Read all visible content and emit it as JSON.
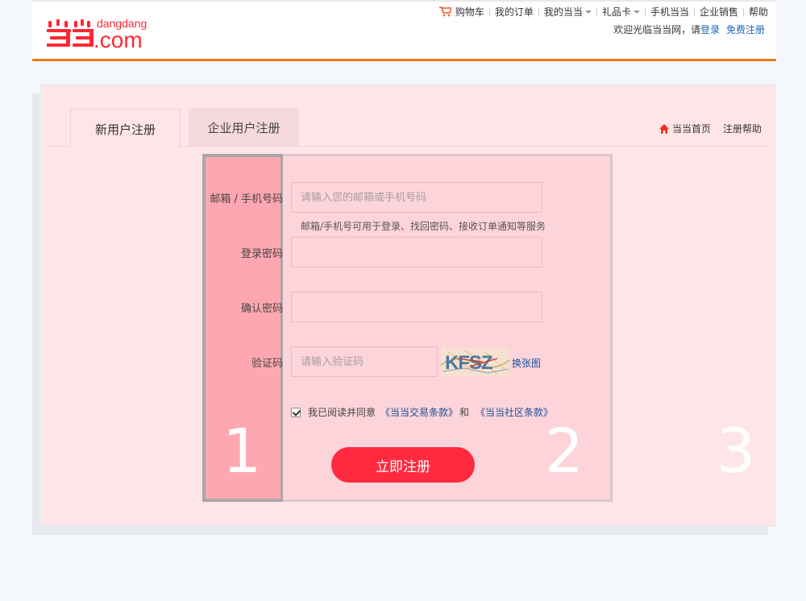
{
  "header": {
    "logo_text": "dangdang.com",
    "nav": [
      {
        "label": "购物车",
        "icon": "cart-icon"
      },
      {
        "label": "我的订单"
      },
      {
        "label": "我的当当",
        "caret": true
      },
      {
        "label": "礼品卡",
        "caret": true
      },
      {
        "label": "手机当当"
      },
      {
        "label": "企业销售"
      },
      {
        "label": "帮助"
      }
    ],
    "welcome": "欢迎光临当当网，请",
    "login": "登录",
    "register": "免费注册"
  },
  "tabs": {
    "active": "新用户注册",
    "inactive": "企业用户注册"
  },
  "right_links": {
    "home": "当当首页",
    "help": "注册帮助"
  },
  "form": {
    "email_label": "邮箱 / 手机号码",
    "email_placeholder": "请输入您的邮箱或手机号码",
    "email_hint": "邮箱/手机号可用于登录、找回密码、接收订单通知等服务",
    "password_label": "登录密码",
    "confirm_label": "确认密码",
    "captcha_label": "验证码",
    "captcha_placeholder": "请输入验证码",
    "captcha_text": "KFSZ",
    "refresh": "换张图",
    "agree_text": "我已阅读并同意",
    "terms_trade": "《当当交易条款》",
    "and": "和",
    "terms_community": "《当当社区条款》",
    "submit": "立即注册"
  },
  "overlay_numbers": [
    "1",
    "2",
    "3"
  ],
  "colors": {
    "brand": "#ff2832",
    "accent_line": "#ee7a1a",
    "button": "#ff2a3f",
    "link": "#1a4f99"
  }
}
